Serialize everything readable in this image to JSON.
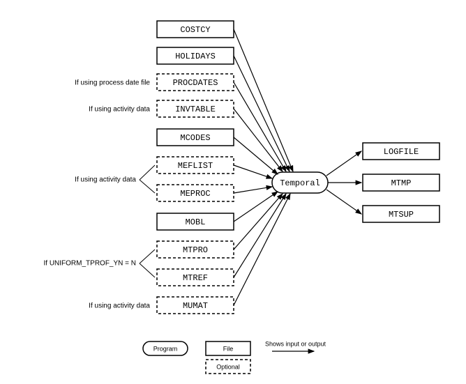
{
  "program": {
    "label": "Temporal"
  },
  "inputs": [
    {
      "id": "costcy",
      "label": "COSTCY",
      "optional": false,
      "cond": null
    },
    {
      "id": "holidays",
      "label": "HOLIDAYS",
      "optional": false,
      "cond": null
    },
    {
      "id": "procdates",
      "label": "PROCDATES",
      "optional": true,
      "cond": "If using process date file"
    },
    {
      "id": "invtable",
      "label": "INVTABLE",
      "optional": true,
      "cond": "If using activity data"
    },
    {
      "id": "mcodes",
      "label": "MCODES",
      "optional": false,
      "cond": null
    },
    {
      "id": "meflist",
      "label": "MEFLIST",
      "optional": true,
      "cond": "group-activity"
    },
    {
      "id": "meproc",
      "label": "MEPROC",
      "optional": true,
      "cond": "group-activity"
    },
    {
      "id": "mobl",
      "label": "MOBL",
      "optional": false,
      "cond": null
    },
    {
      "id": "mtpro",
      "label": "MTPRO",
      "optional": true,
      "cond": "group-uniform"
    },
    {
      "id": "mtref",
      "label": "MTREF",
      "optional": true,
      "cond": "group-uniform"
    },
    {
      "id": "mumat",
      "label": "MUMAT",
      "optional": true,
      "cond": "If using activity data"
    }
  ],
  "groups": {
    "group-activity": "If using activity data",
    "group-uniform": "If UNIFORM_TPROF_YN = N"
  },
  "outputs": [
    {
      "id": "logfile",
      "label": "LOGFILE"
    },
    {
      "id": "mtmp",
      "label": "MTMP"
    },
    {
      "id": "mtsup",
      "label": "MTSUP"
    }
  ],
  "legend": {
    "program": "Program",
    "file": "File",
    "optional": "Optional",
    "arrow": "Shows input or output"
  }
}
